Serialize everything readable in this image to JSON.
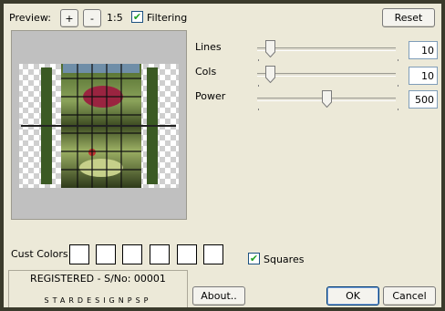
{
  "preview": {
    "label": "Preview:",
    "zoom_in": "+",
    "zoom_out": "-",
    "ratio": "1:5",
    "filtering_label": "Filtering",
    "filtering_checked": true
  },
  "reset_label": "Reset",
  "sliders": [
    {
      "label": "Lines",
      "value": "10",
      "min": 0,
      "max": 100,
      "level": 10
    },
    {
      "label": "Cols",
      "value": "10",
      "min": 0,
      "max": 100,
      "level": 10
    },
    {
      "label": "Power",
      "value": "500",
      "min": 0,
      "max": 1000,
      "level": 500
    }
  ],
  "cust_colors": {
    "label": "Cust Colors:",
    "swatches": [
      "#ffffff",
      "#ffffff",
      "#ffffff",
      "#ffffff",
      "#ffffff",
      "#ffffff"
    ]
  },
  "squares": {
    "label": "Squares",
    "checked": true
  },
  "registration": {
    "line1": "REGISTERED - S/No: 00001",
    "line2": "STARDESIGNPSP"
  },
  "buttons": {
    "about": "About..",
    "ok": "OK",
    "cancel": "Cancel"
  },
  "colors": {
    "frame": "#3b3b2c",
    "dialog": "#ece9d8",
    "accent": "#003c74"
  }
}
